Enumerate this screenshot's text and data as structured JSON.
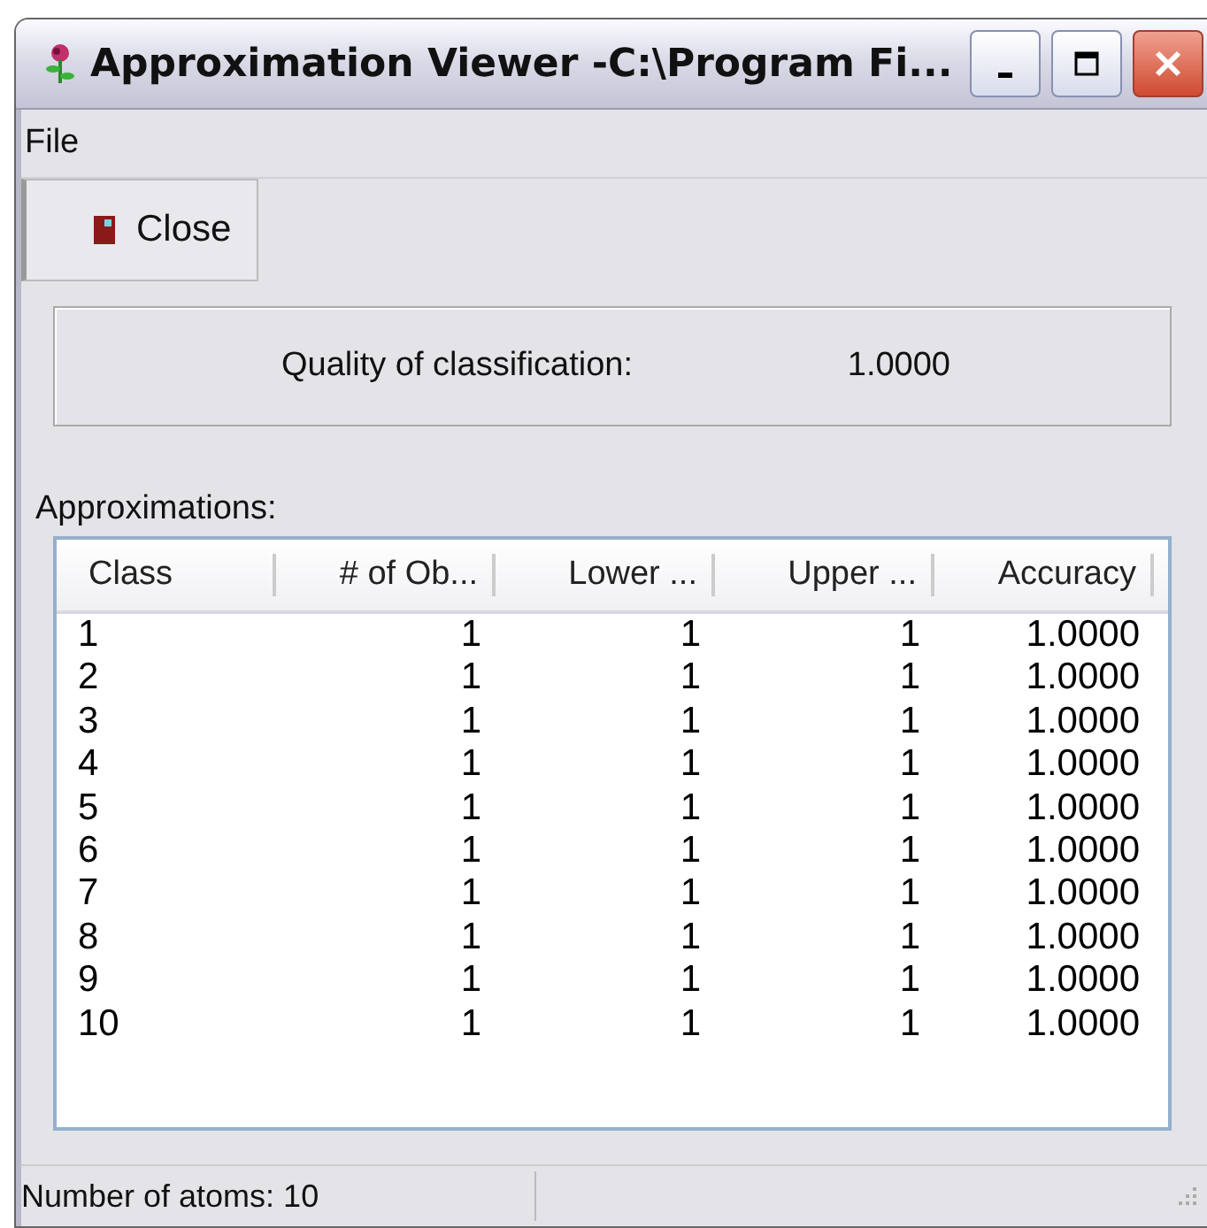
{
  "window": {
    "title": "Approximation Viewer -C:\\Program Fi..."
  },
  "menu": [
    "File"
  ],
  "toolbar": {
    "close_button": "Close"
  },
  "quality": {
    "label": "Quality of classification:",
    "value": "1.0000"
  },
  "list_label": "Approximations:",
  "table": {
    "columns": [
      "Class",
      "# of Ob...",
      "Lower ...",
      "Upper ...",
      "Accuracy"
    ],
    "rows": [
      [
        "1",
        "1",
        "1",
        "1",
        "1.0000"
      ],
      [
        "2",
        "1",
        "1",
        "1",
        "1.0000"
      ],
      [
        "3",
        "1",
        "1",
        "1",
        "1.0000"
      ],
      [
        "4",
        "1",
        "1",
        "1",
        "1.0000"
      ],
      [
        "5",
        "1",
        "1",
        "1",
        "1.0000"
      ],
      [
        "6",
        "1",
        "1",
        "1",
        "1.0000"
      ],
      [
        "7",
        "1",
        "1",
        "1",
        "1.0000"
      ],
      [
        "8",
        "1",
        "1",
        "1",
        "1.0000"
      ],
      [
        "9",
        "1",
        "1",
        "1",
        "1.0000"
      ],
      [
        "10",
        "1",
        "1",
        "1",
        "1.0000"
      ]
    ]
  },
  "status_bar": "Number of atoms: 10"
}
